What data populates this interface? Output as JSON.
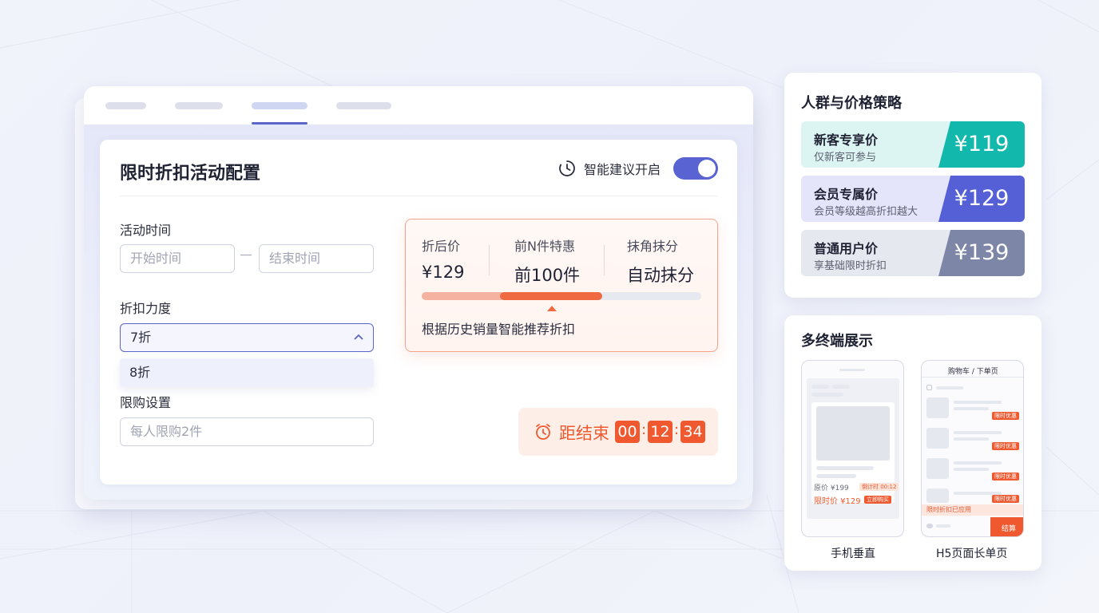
{
  "window": {
    "tabs": 4,
    "active_tab_index": 2
  },
  "config": {
    "title": "限时折扣活动配置",
    "smart_toggle": {
      "label": "智能建议开启",
      "on": true
    },
    "time": {
      "label": "活动时间",
      "start_placeholder": "开始时间",
      "end_placeholder": "结束时间"
    },
    "discount": {
      "label": "折扣力度",
      "selected": "7折",
      "option_highlighted": "8折"
    },
    "limit": {
      "label": "限购设置",
      "placeholder": "每人限购2件"
    }
  },
  "panel": {
    "metrics": [
      {
        "label": "折后价",
        "value": "¥129"
      },
      {
        "label": "前N件特惠",
        "value": "前100件"
      },
      {
        "label": "抹角抹分",
        "value": "自动抹分"
      }
    ],
    "note": "根据历史销量智能推荐折扣"
  },
  "countdown": {
    "label": "距结束",
    "hh": "00",
    "mm": "12",
    "ss": "34"
  },
  "pricing": {
    "title": "人群与价格策略",
    "tiers": [
      {
        "name": "新客专享价",
        "desc": "仅新客可参与",
        "price": "¥119",
        "color": "#13b8ac",
        "bg": "#dff5f3"
      },
      {
        "name": "会员专属价",
        "desc": "会员等级越高折扣越大",
        "price": "¥129",
        "color": "#5660d6",
        "bg": "#e6e7fb"
      },
      {
        "name": "普通用户价",
        "desc": "享基础限时折扣",
        "price": "¥139",
        "color": "#7d86a6",
        "bg": "#e8eaf1"
      }
    ]
  },
  "devices": {
    "title": "多终端展示",
    "phone": {
      "caption": "手机垂直",
      "orig_price": "原价 ¥199",
      "badge": "倒计时 00:12",
      "sale_label": "限时价 ¥129",
      "buy": "立即购买"
    },
    "h5": {
      "caption": "H5页面长单页",
      "header": "购物车 / 下单页",
      "tag": "限时优惠",
      "footer_note": "限时折扣已应用",
      "pay": "结算"
    }
  }
}
